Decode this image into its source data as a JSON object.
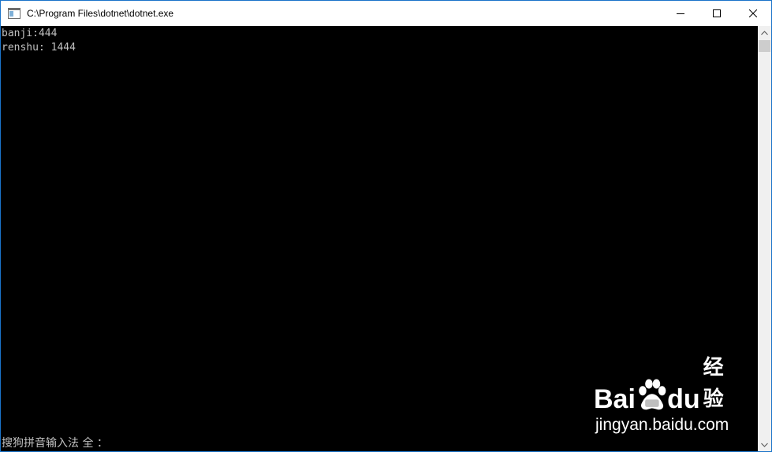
{
  "window": {
    "title": "C:\\Program Files\\dotnet\\dotnet.exe",
    "icon": "console-app-icon",
    "accent_border": "#1a73c9",
    "caption_buttons": [
      {
        "name": "minimize-button",
        "icon": "minimize-icon"
      },
      {
        "name": "maximize-button",
        "icon": "maximize-icon"
      },
      {
        "name": "close-button",
        "icon": "close-icon"
      }
    ]
  },
  "console": {
    "background": "#000000",
    "foreground": "#c0c0c0",
    "lines": [
      "banji:444",
      "renshu: 1444"
    ]
  },
  "ime": {
    "status": "搜狗拼音输入法 全 ："
  },
  "watermark": {
    "brand_left": "Bai",
    "brand_right": "du",
    "brand_suffix": "经验",
    "url": "jingyan.baidu.com",
    "icon": "baidu-paw-icon"
  }
}
